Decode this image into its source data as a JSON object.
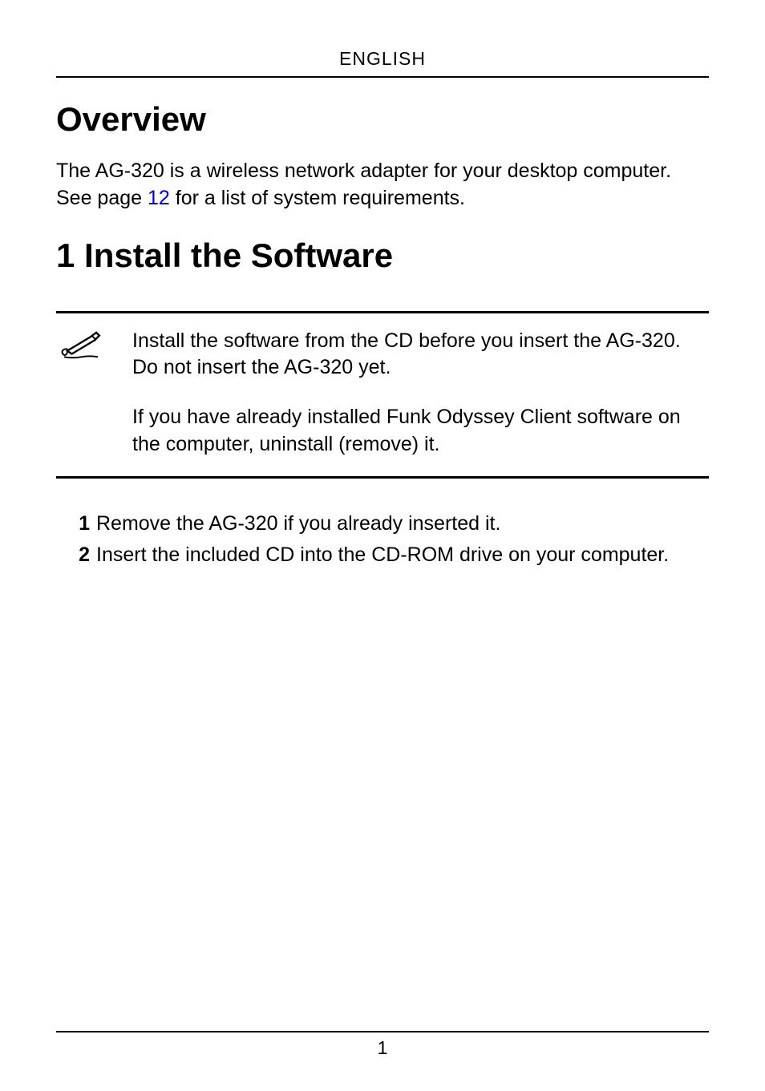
{
  "header": {
    "language": "ENGLISH"
  },
  "section_overview": {
    "title": "Overview",
    "para_before_link": "The AG-320 is a wireless network adapter for your desktop computer. See page ",
    "link_text": "12",
    "para_after_link": " for a list of system requirements."
  },
  "section_install": {
    "title": "1 Install the Software",
    "note_para1": "Install the software from the CD before you insert the AG-320. Do not insert the AG-320 yet.",
    "note_para2": "If you have already installed Funk Odyssey Client software on the computer, uninstall (remove) it.",
    "steps": [
      {
        "num": "1",
        "text": "Remove the AG-320 if you already inserted it."
      },
      {
        "num": "2",
        "text": "Insert the included CD into the CD-ROM drive on your computer."
      }
    ]
  },
  "footer": {
    "page_number": "1"
  }
}
